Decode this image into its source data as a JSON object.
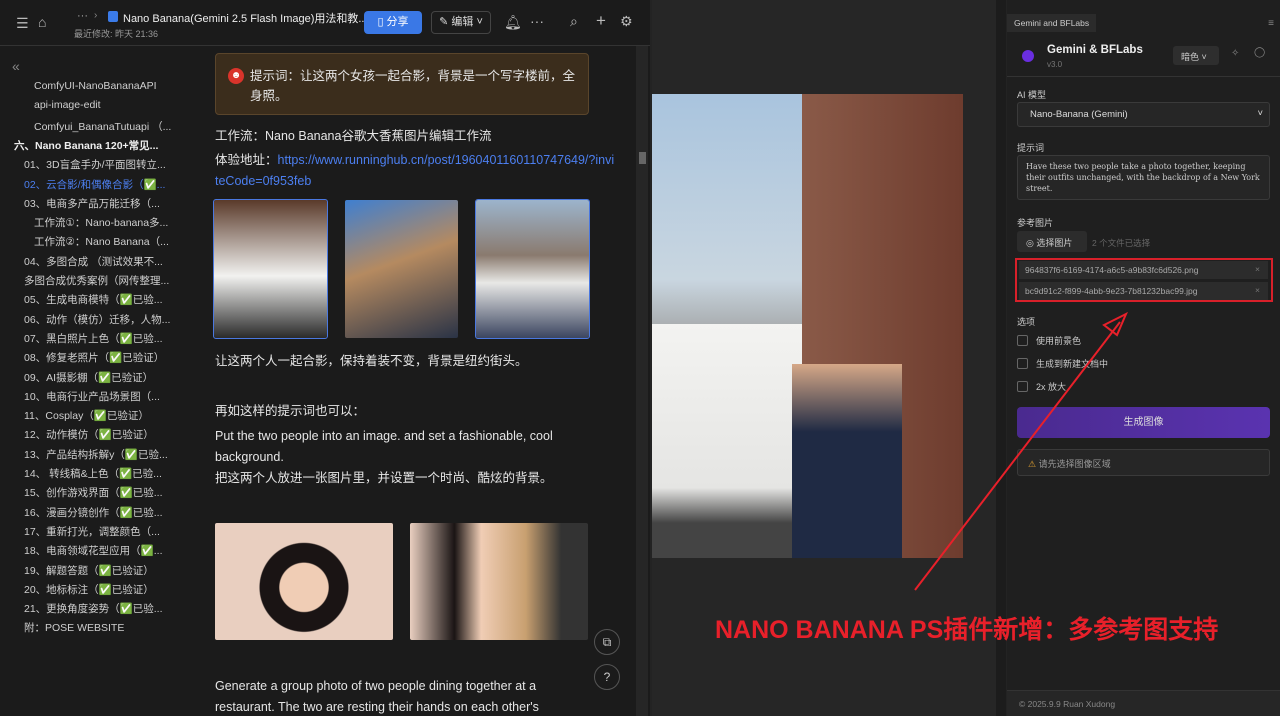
{
  "doc": {
    "breadcrumb_more": "···",
    "title": "Nano Banana(Gemini 2.5 Flash Image)用法和教...",
    "last_modified": "最近修改: 昨天 21:36",
    "share_label": "分享",
    "edit_label": "编辑",
    "more": "···",
    "icons": [
      "toc-icon",
      "home-icon",
      "doc-icon",
      "bell-icon",
      "search-icon",
      "plus-icon",
      "gear-icon"
    ]
  },
  "sidebar": {
    "items": [
      {
        "label": "ComfyUI-NanoBananaAPI",
        "level": 2
      },
      {
        "label": "api-image-edit",
        "level": 2
      },
      {
        "label": "Comfyui_BananaTutuapi （...",
        "level": 2
      },
      {
        "label": "六、Nano Banana 120+常见...",
        "level": 0,
        "bold": true
      },
      {
        "label": "01、3D盲盒手办/平面图转立...",
        "level": 1
      },
      {
        "label": "02、云合影/和偶像合影（✅...",
        "level": 1,
        "active": true
      },
      {
        "label": "03、电商多产品万能迁移（...",
        "level": 1
      },
      {
        "label": "工作流①：Nano-banana多...",
        "level": 2
      },
      {
        "label": "工作流②：Nano Banana（...",
        "level": 2
      },
      {
        "label": "04、多图合成 （测试效果不...",
        "level": 1
      },
      {
        "label": "多图合成优秀案例（网传整理...",
        "level": 1
      },
      {
        "label": "05、生成电商模特（✅已验...",
        "level": 1
      },
      {
        "label": "06、动作（模仿）迁移，人物...",
        "level": 1
      },
      {
        "label": "07、黑白照片上色（✅已验...",
        "level": 1
      },
      {
        "label": "08、修复老照片（✅已验证）",
        "level": 1
      },
      {
        "label": "09、AI摄影棚（✅已验证）",
        "level": 1
      },
      {
        "label": "10、电商行业产品场景图（...",
        "level": 1
      },
      {
        "label": "11、Cosplay（✅已验证）",
        "level": 1
      },
      {
        "label": "12、动作模仿（✅已验证）",
        "level": 1
      },
      {
        "label": "13、产品结构拆解y（✅已验...",
        "level": 1
      },
      {
        "label": "14、 转线稿&上色（✅已验...",
        "level": 1
      },
      {
        "label": "15、创作游戏界面（✅已验...",
        "level": 1
      },
      {
        "label": "16、漫画分镜创作（✅已验...",
        "level": 1
      },
      {
        "label": "17、重新打光，调整颜色（...",
        "level": 1
      },
      {
        "label": "18、电商领域花型应用（✅...",
        "level": 1
      },
      {
        "label": "19、解题答题（✅已验证）",
        "level": 1
      },
      {
        "label": "20、地标标注（✅已验证）",
        "level": 1
      },
      {
        "label": "21、更换角度姿势（✅已验...",
        "level": 1
      },
      {
        "label": "附：POSE WEBSITE",
        "level": 1
      }
    ]
  },
  "content": {
    "callout": "提示词：让这两个女孩一起合影，背景是一个写字楼前，全身照。",
    "workflow": "工作流：Nano Banana谷歌大香蕉图片编辑工作流",
    "try_label": "体验地址：",
    "try_link": "https://www.runninghub.cn/post/1960401160110747649/?inviteCode=0f953feb",
    "p1": "让这两个人一起合影，保持着装不变，背景是纽约街头。",
    "p2": "再如这样的提示词也可以：",
    "p3": "Put the two people into an image. and set a fashionable, cool background.",
    "p4": "把这两个人放进一张图片里，并设置一个时尚、酷炫的背景。",
    "p5": "Generate a group photo of two people dining together at a restaurant. The two are resting their hands on each other's"
  },
  "panel": {
    "tab": "Gemini and BFLabs",
    "title": "Gemini & BFLabs",
    "version": "v3.0",
    "theme": "暗色",
    "model_label": "AI 模型",
    "model_value": "Nano-Banana (Gemini)",
    "prompt_label": "提示词",
    "prompt_value": "Have these two people take a photo together, keeping their outfits unchanged, with the backdrop of a New York street.",
    "ref_label": "参考图片",
    "choose_label": "选择图片",
    "selected_count": "2 个文件已选择",
    "files": [
      "964837f6-6169-4174-a6c5-a9b83fc6d526.png",
      "bc9d91c2-f899-4abb-9e23-7b81232bac99.jpg"
    ],
    "options_label": "选项",
    "options": [
      "使用前景色",
      "生成到新建文档中",
      "2x 放大"
    ],
    "generate_label": "生成图像",
    "warning": "请先选择图像区域",
    "footer": "© 2025.9.9 Ruan Xudong",
    "accent": "#5a33b0"
  },
  "annotation": "NANO  BANANA PS插件新增：多参考图支持"
}
